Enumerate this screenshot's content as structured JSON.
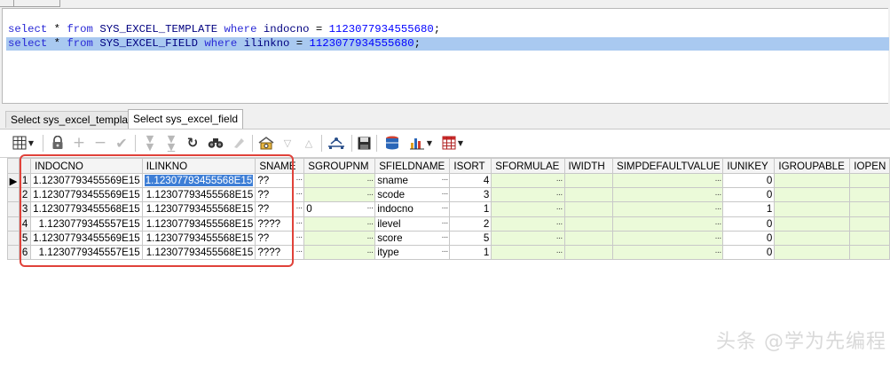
{
  "editor": {
    "lines": [
      {
        "kw1": "select",
        "star": " * ",
        "kw2": "from",
        "table": " SYS_EXCEL_TEMPLATE ",
        "kw3": "where",
        "col": " indocno ",
        "op": "=",
        "val": " 1123077934555680",
        "end": ";"
      },
      {
        "kw1": "select",
        "star": " * ",
        "kw2": "from",
        "table": " SYS_EXCEL_FIELD ",
        "kw3": "where",
        "col": " ilinkno ",
        "op": "=",
        "val": " 1123077934555680",
        "end": ";"
      }
    ]
  },
  "result_tabs": [
    {
      "label": "Select sys_excel_template"
    },
    {
      "label": "Select sys_excel_field"
    }
  ],
  "toolbar": {
    "icons": [
      "grid-view-icon",
      "lock-icon",
      "add-record-icon",
      "delete-record-icon",
      "post-edit-icon",
      "fetch-next-icon",
      "fetch-last-icon",
      "refresh-icon",
      "find-icon",
      "clear-icon",
      "query-by-example-icon",
      "filter-icon",
      "sort-icon",
      "link-icon",
      "save-icon",
      "export-icon",
      "chart-icon",
      "table-options-icon"
    ]
  },
  "grid": {
    "columns": [
      "INDOCNO",
      "ILINKNO",
      "SNAME",
      "SGROUPNM",
      "SFIELDNAME",
      "ISORT",
      "SFORMULAE",
      "IWIDTH",
      "SIMPDEFAULTVALUE",
      "IUNIKEY",
      "IGROUPABLE",
      "IOPEN"
    ],
    "rows": [
      {
        "n": "1",
        "marker": "▶",
        "indocno": "1.12307793455569E15",
        "ilinkno": "1.12307793455568E15",
        "sname": "??",
        "sgroupnm": "",
        "sfieldname": "sname",
        "isort": "4",
        "iunikey": "0"
      },
      {
        "n": "2",
        "marker": "",
        "indocno": "1.12307793455569E15",
        "ilinkno": "1.12307793455568E15",
        "sname": "??",
        "sgroupnm": "",
        "sfieldname": "scode",
        "isort": "3",
        "iunikey": "0"
      },
      {
        "n": "3",
        "marker": "",
        "indocno": "1.12307793455568E15",
        "ilinkno": "1.12307793455568E15",
        "sname": "??",
        "sgroupnm": "0",
        "sfieldname": "indocno",
        "isort": "1",
        "iunikey": "1"
      },
      {
        "n": "4",
        "marker": "",
        "indocno": "1.1230779345557E15",
        "ilinkno": "1.12307793455568E15",
        "sname": "????",
        "sgroupnm": "",
        "sfieldname": "ilevel",
        "isort": "2",
        "iunikey": "0"
      },
      {
        "n": "5",
        "marker": "",
        "indocno": "1.12307793455569E15",
        "ilinkno": "1.12307793455568E15",
        "sname": "??",
        "sgroupnm": "",
        "sfieldname": "score",
        "isort": "5",
        "iunikey": "0"
      },
      {
        "n": "6",
        "marker": "",
        "indocno": "1.1230779345557E15",
        "ilinkno": "1.12307793455568E15",
        "sname": "????",
        "sgroupnm": "",
        "sfieldname": "itype",
        "isort": "1",
        "iunikey": "0"
      }
    ],
    "ellipsis": "···"
  },
  "watermark": "头条 @学为先编程",
  "colors": {
    "annotation": "#e0423a",
    "selection": "#3d7ed6",
    "row_tint": "#ebfad9",
    "keyword": "#2929d6"
  }
}
